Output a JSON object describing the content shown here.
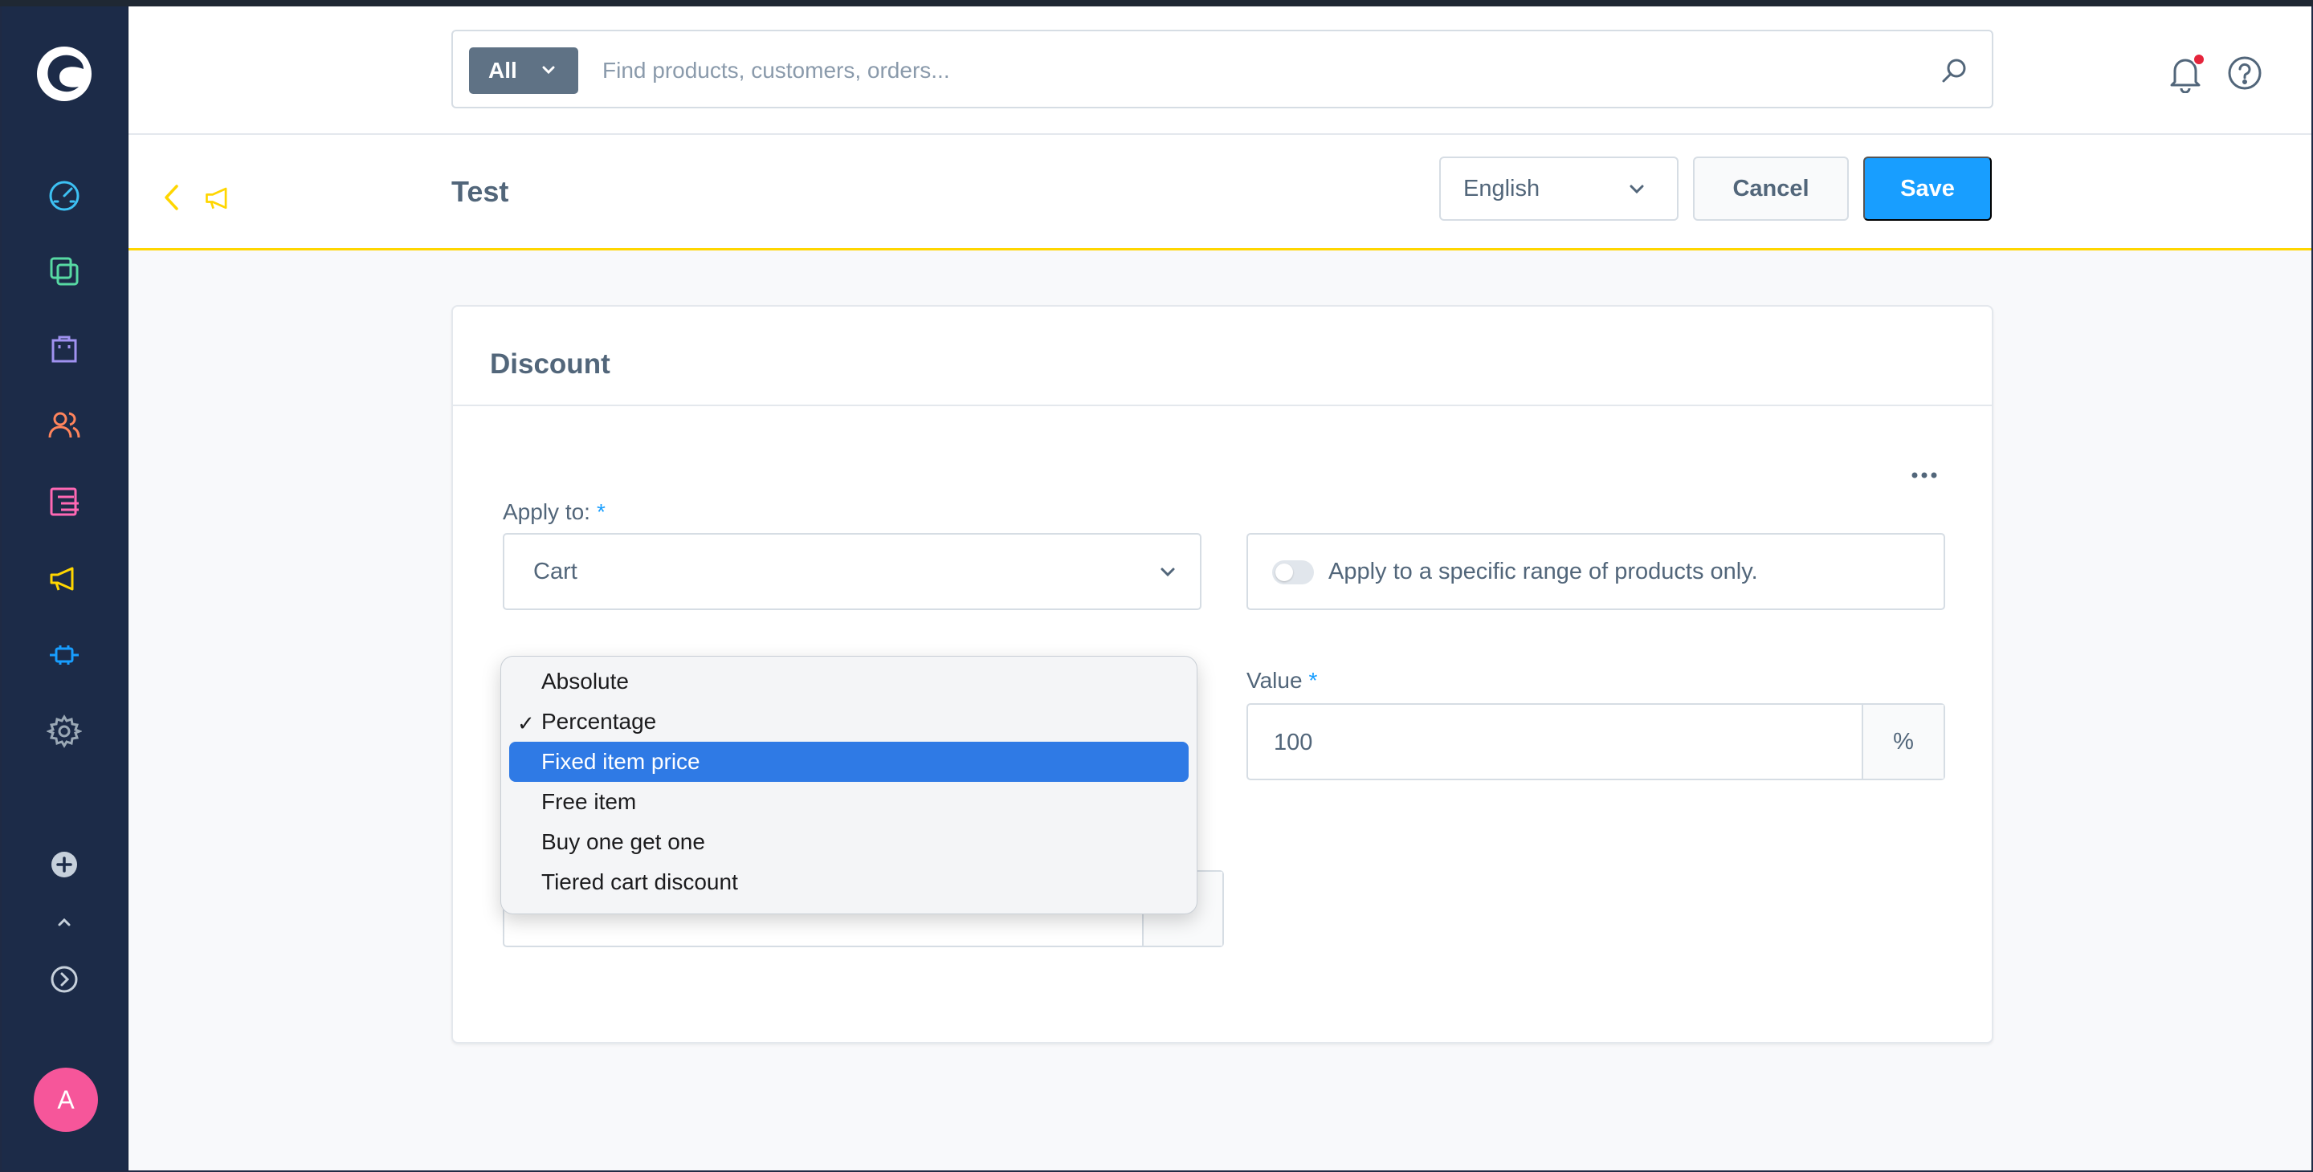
{
  "search": {
    "type_label": "All",
    "placeholder": "Find products, customers, orders..."
  },
  "header": {
    "title": "Test",
    "language": "English",
    "cancel_label": "Cancel",
    "save_label": "Save"
  },
  "card": {
    "title": "Discount",
    "apply_to_label": "Apply to:",
    "apply_to_value": "Cart",
    "range_switch_label": "Apply to a specific range of products only.",
    "value_label": "Value",
    "value": "100",
    "value_suffix": "%",
    "required_mark": "*"
  },
  "dropdown": {
    "options": [
      "Absolute",
      "Percentage",
      "Fixed item price",
      "Free item",
      "Buy one get one",
      "Tiered cart discount"
    ],
    "checked": "Percentage",
    "highlighted": "Fixed item price",
    "check_mark": "✓"
  },
  "user": {
    "avatar_initial": "A"
  },
  "colors": {
    "sidebar": "#1c2b48",
    "accent": "#189eff",
    "header_border": "#ffd600",
    "avatar": "#f6569a",
    "menu_highlight": "#2f7ae5"
  }
}
